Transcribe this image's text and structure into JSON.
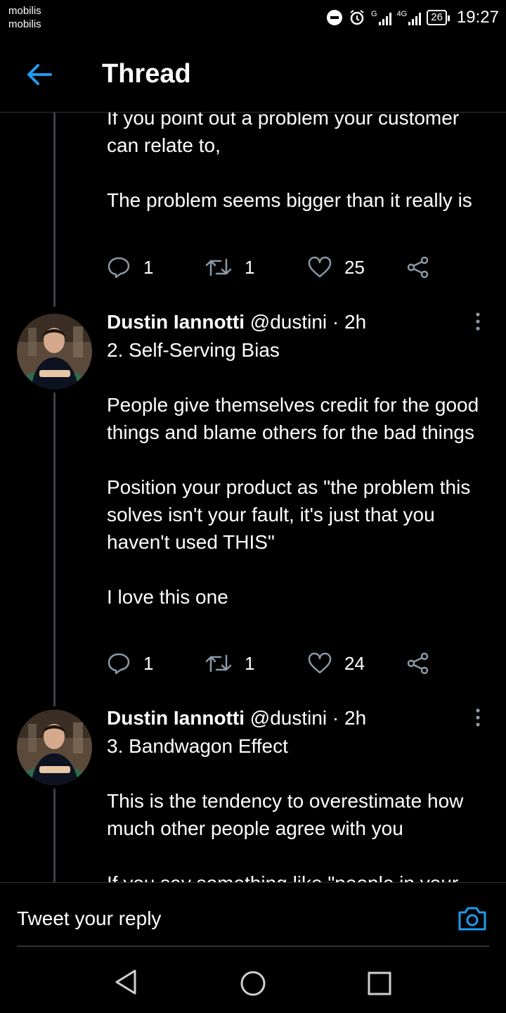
{
  "status_bar": {
    "carrier_line1": "mobilis",
    "carrier_line2": "mobilis",
    "network_1": "G",
    "network_2": "4G",
    "battery": "26",
    "time": "19:27"
  },
  "header": {
    "title": "Thread",
    "back_icon": "arrow-left-icon"
  },
  "tweets": [
    {
      "text": "If you point out a problem your customer can relate to,\n\nThe problem seems bigger than it really is",
      "replies": "1",
      "retweets": "1",
      "likes": "25"
    },
    {
      "author": "Dustin Iannotti",
      "handle": "@dustini",
      "time": "· 2h",
      "text": "2. Self-Serving Bias\n\nPeople give themselves credit for the good things and blame others for the bad things\n\nPosition your product as \"the problem this solves isn't your fault, it's just that you haven't used THIS\"\n\nI love this one",
      "replies": "1",
      "retweets": "1",
      "likes": "24"
    },
    {
      "author": "Dustin Iannotti",
      "handle": "@dustini",
      "time": "· 2h",
      "text": "3. Bandwagon Effect\n\nThis is the tendency to overestimate how much other people agree with you\n\nIf you say something like \"people in your"
    }
  ],
  "reply_bar": {
    "placeholder": "Tweet your reply",
    "camera_icon": "camera-icon"
  },
  "nav_bar": {
    "back": "triangle-back-icon",
    "home": "circle-home-icon",
    "recents": "square-recents-icon"
  },
  "colors": {
    "background": "#000000",
    "accent": "#1d9bf0",
    "thread_line": "#3d4146",
    "icon_gray": "#8b98a5"
  }
}
